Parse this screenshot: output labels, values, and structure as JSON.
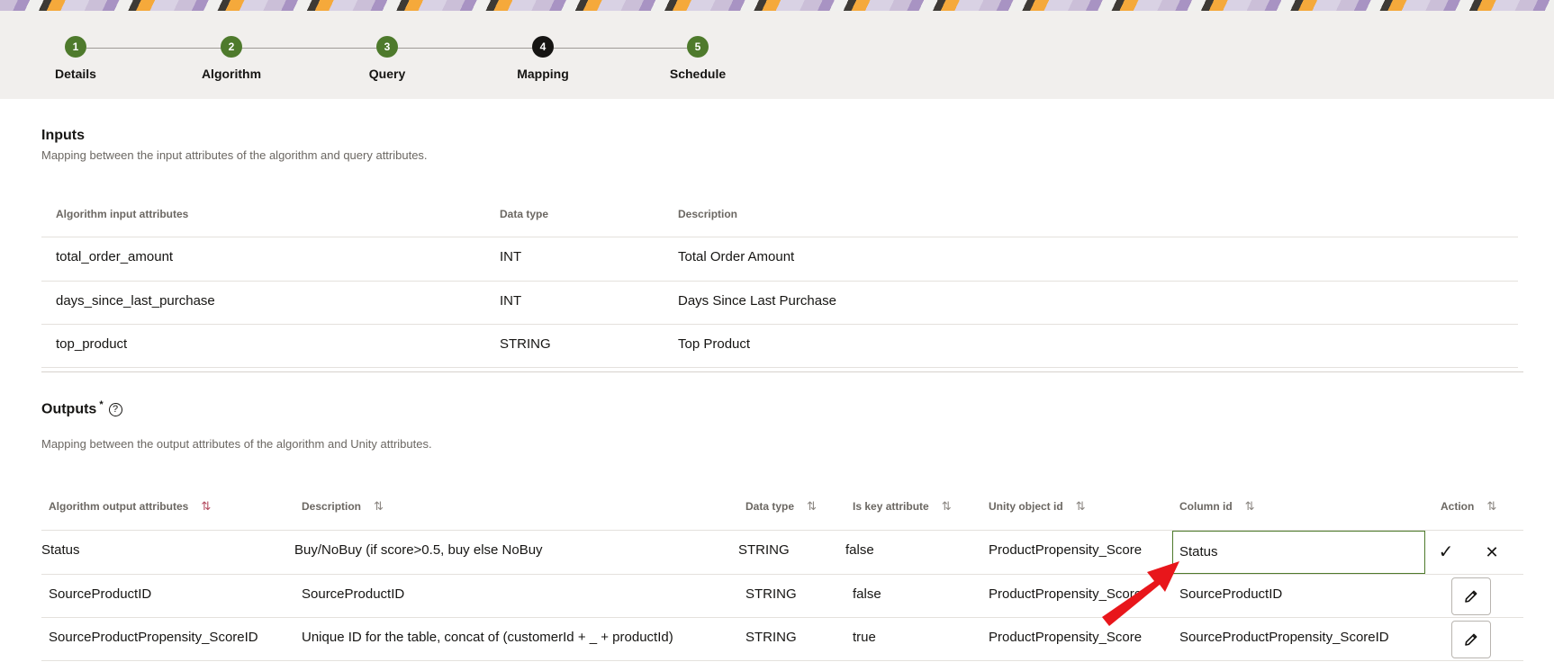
{
  "stepper": {
    "steps": [
      {
        "number": "1",
        "label": "Details"
      },
      {
        "number": "2",
        "label": "Algorithm"
      },
      {
        "number": "3",
        "label": "Query"
      },
      {
        "number": "4",
        "label": "Mapping"
      },
      {
        "number": "5",
        "label": "Schedule"
      }
    ],
    "active_step": "4"
  },
  "inputs": {
    "title": "Inputs",
    "description": "Mapping between the input attributes of the algorithm and query attributes.",
    "headers": [
      "Algorithm input attributes",
      "Data type",
      "Description"
    ],
    "rows": [
      [
        "total_order_amount",
        "INT",
        "Total Order Amount"
      ],
      [
        "days_since_last_purchase",
        "INT",
        "Days Since Last Purchase"
      ],
      [
        "top_product",
        "STRING",
        "Top Product"
      ]
    ]
  },
  "outputs": {
    "title": "Outputs",
    "required_mark": "*",
    "help_icon": "?",
    "description": "Mapping between the output attributes of the algorithm and Unity attributes.",
    "headers": [
      "Algorithm output attributes",
      "Description",
      "Data type",
      "Is key attribute",
      "Unity object id",
      "Column id",
      "Action"
    ],
    "sort_icon": "⇅",
    "rows": [
      {
        "attr": "Status",
        "description": "Buy/NoBuy (if score>0.5, buy else NoBuy",
        "data_type": "STRING",
        "is_key": "false",
        "unity_object": "ProductPropensity_Score",
        "column_id": "Status"
      },
      {
        "attr": "SourceProductID",
        "description": "SourceProductID",
        "data_type": "STRING",
        "is_key": "false",
        "unity_object": "ProductPropensity_Score",
        "column_id": "SourceProductID"
      },
      {
        "attr": "SourceProductPropensity_ScoreID",
        "description": "Unique ID for the table, concat of (customerId + _ + productId)",
        "data_type": "STRING",
        "is_key": "true",
        "unity_object": "ProductPropensity_Score",
        "column_id": "SourceProductPropensity_ScoreID"
      }
    ],
    "confirm_icon": "✓",
    "cancel_icon": "✕"
  },
  "colors": {
    "step_complete": "#4e7a2c",
    "step_active": "#161513",
    "annotation_arrow": "#e8161b"
  }
}
